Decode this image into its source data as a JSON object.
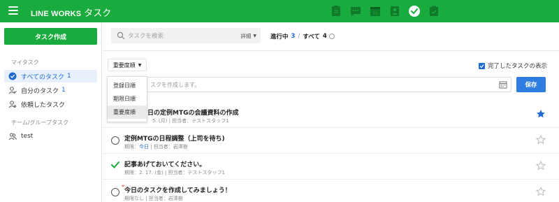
{
  "header": {
    "brand": "LINE WORKS",
    "app_name": "タスク",
    "app_icons": [
      "notes-icon",
      "chat-icon",
      "calendar-icon",
      "contacts-icon",
      "task-check-icon",
      "clipboard-icon"
    ]
  },
  "sidebar": {
    "create_label": "タスク作成",
    "my_task_label": "マイタスク",
    "items": [
      {
        "label": "すべてのタスク",
        "count": "1"
      },
      {
        "label": "自分のタスク",
        "count": "1"
      },
      {
        "label": "依頼したタスク",
        "count": ""
      }
    ],
    "team_label": "チーム/グループタスク",
    "groups": [
      {
        "label": "test"
      }
    ]
  },
  "search": {
    "placeholder": "タスクを検索",
    "detail_label": "詳細"
  },
  "status": {
    "in_progress_label": "進行中",
    "in_progress_count": "3",
    "separator": "/",
    "all_label": "すべて",
    "all_count": "4"
  },
  "sort": {
    "current": "重要度順",
    "options": [
      "登録日順",
      "期限日順",
      "重要度順"
    ]
  },
  "show_done_label": "完了したタスクの表示",
  "new_task": {
    "placeholder": "スクを作成します。",
    "save_label": "保存"
  },
  "tasks": [
    {
      "title": "日の定例MTGの会議資料の作成",
      "meta_due": "",
      "meta_due_value": "5. (月)",
      "meta_assignee": "担当者：テストスタッフ1",
      "starred": true
    },
    {
      "title": "定例MTGの日程調整（上司を待ち)",
      "meta_due": "期限：",
      "meta_due_value": "今日",
      "meta_assignee": "担当者：岩澤樹",
      "starred": false
    },
    {
      "title": "記事あげておいてください。",
      "meta_due": "期限：",
      "meta_due_value": "2. 17. (金)",
      "meta_assignee": "担当者：テストスタッフ1",
      "starred": false
    },
    {
      "title": "今日のタスクを作成してみましょう！",
      "meta_due": "期限なし",
      "meta_due_value": "",
      "meta_assignee": "担当者：岩澤樹",
      "starred": false
    }
  ],
  "colors": {
    "brand_green": "#1aab3e",
    "accent_blue": "#1d6ad0",
    "save_blue": "#2d7de0"
  }
}
